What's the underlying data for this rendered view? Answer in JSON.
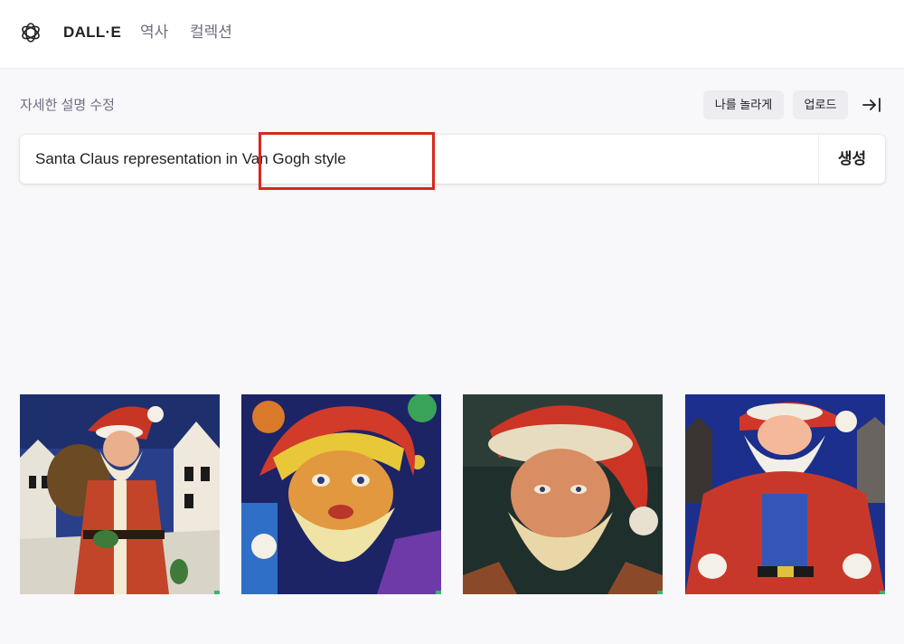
{
  "header": {
    "brand": "DALL·E",
    "nav": [
      "역사",
      "컬렉션"
    ],
    "logo_icon": "openai-logo-icon"
  },
  "prompt_section": {
    "label": "자세한 설명 수정",
    "surprise_label": "나를 놀라게",
    "upload_label": "업로드",
    "collapse_icon": "arrow-right-to-bar-icon",
    "input_value": "Santa Claus representation in Van Gogh style",
    "generate_label": "생성",
    "highlight_color": "#d9271c"
  },
  "results": {
    "images": [
      "santa-with-sack-village-painting",
      "santa-colorful-closeup-painting",
      "santa-portrait-painting",
      "santa-blue-background-painting"
    ]
  },
  "colors": {
    "background": "#f8f8fb",
    "text": "#202123",
    "muted": "#6e6e80",
    "pill": "#ececf1"
  }
}
